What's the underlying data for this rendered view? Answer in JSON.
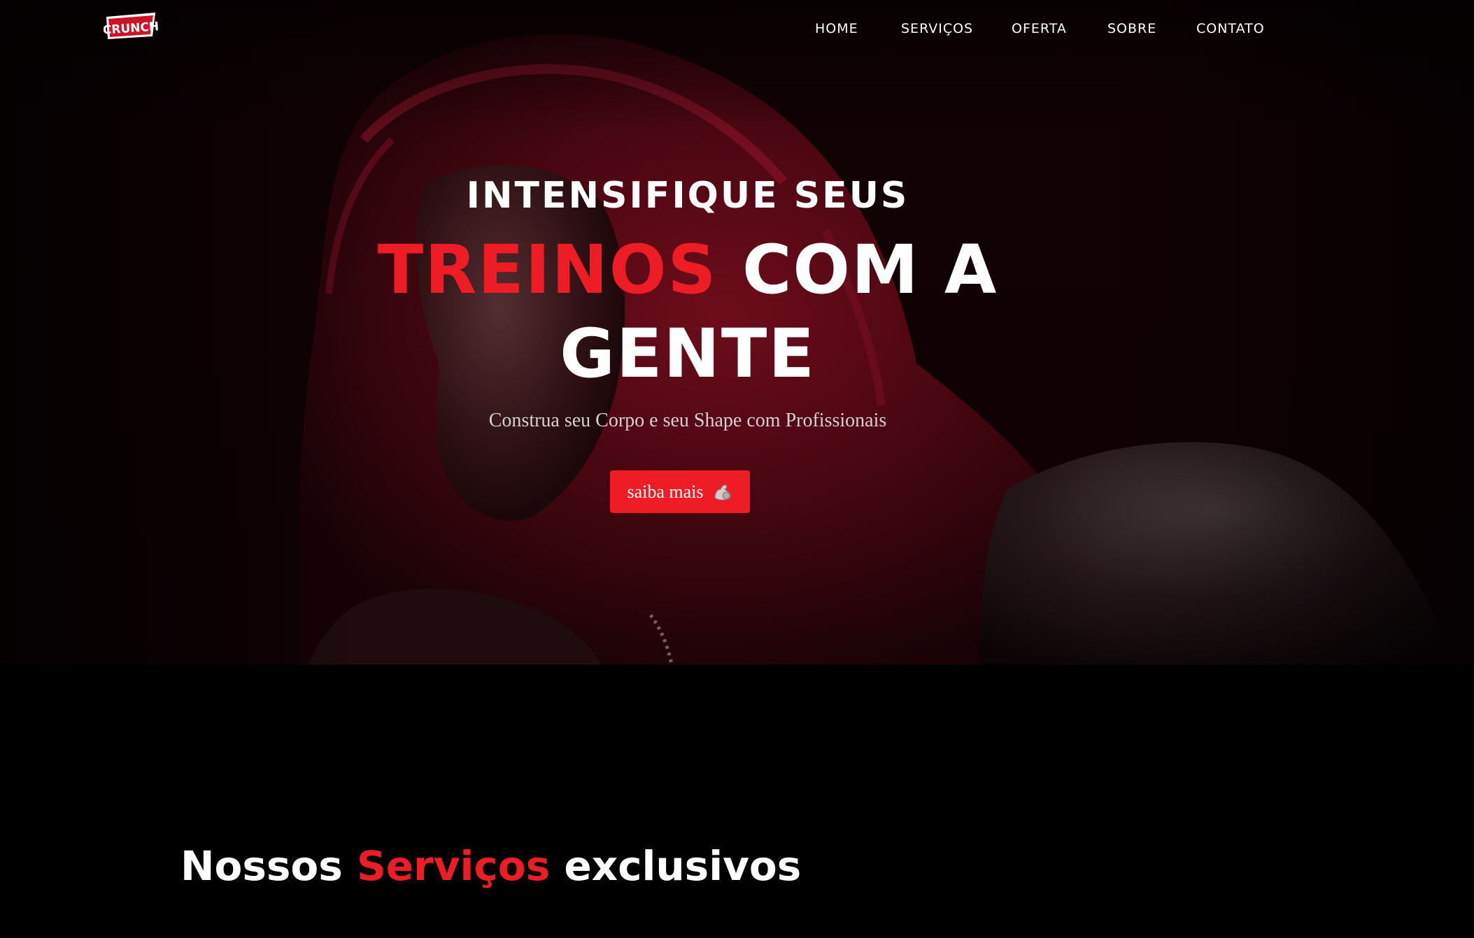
{
  "brand": {
    "logo_text": "CRUNCH",
    "accent_color": "#ee1c25"
  },
  "nav": {
    "items": [
      {
        "label": "HOME"
      },
      {
        "label": "SERVIÇOS"
      },
      {
        "label": "OFERTA"
      },
      {
        "label": "SOBRE"
      },
      {
        "label": "CONTATO"
      }
    ]
  },
  "hero": {
    "line1": "INTENSIFIQUE SEUS",
    "line2_accent": "TREINOS",
    "line2_rest": "COM A",
    "line3": "GENTE",
    "subtitle": "Construa seu Corpo e seu Shape com Profissionais",
    "cta_label": "saiba mais",
    "cta_icon": "flexed-biceps-icon",
    "background_image": "hooded-athlete-photo"
  },
  "services": {
    "title_start": "Nossos",
    "title_accent": "Serviços",
    "title_end": "exclusivos"
  }
}
